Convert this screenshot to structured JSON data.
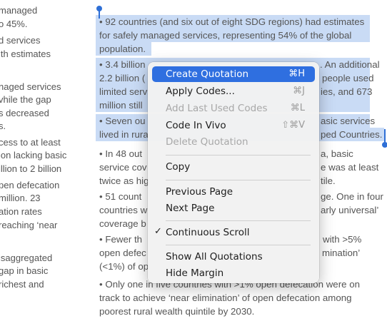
{
  "left_column": [
    "managed",
    "o 45%.",
    "d services",
    "ith estimates",
    "naged services",
    "vhile the gap",
    "s decreased",
    "s.",
    "cess to at least",
    "ion lacking basic",
    "illion to 2 billion",
    "pen defecation",
    "million. 23",
    "ation rates",
    "reaching ‘near",
    "isaggregated",
    "gap in basic",
    "richest and"
  ],
  "main_lines": [
    "•  92 countries (and six out of eight SDG regions) had estimates",
    "for safely managed services, representing 54% of the global",
    "population.",
    "•  3.4 billion",
    "2.2 billion (",
    "limited serv",
    "million still",
    "•  Seven ou",
    "lived in rura",
    "•  In 48 out",
    "service cov",
    "twice as hig",
    "•  51 count",
    "countries w",
    "coverage b",
    "•  Fewer th",
    "open defec",
    "(<1%) of op",
    "•  Only one in five countries with >1% open defecation were on",
    "track to achieve ‘near elimination’ of open defecation among",
    "poorest rural wealth quintile by 2030."
  ],
  "right_fragments": [
    ". An additional",
    "people used",
    "ies, and 673",
    "asic services",
    "ped Countries.",
    "a, basic",
    "e was at least",
    "tile.",
    "ge. One in four",
    "arly universal’",
    "with >5%",
    "mination’"
  ],
  "context_menu": {
    "items": [
      {
        "label": "Create Quotation",
        "shortcut": "⌘H",
        "highlighted": true,
        "disabled": false
      },
      {
        "label": "Apply Codes...",
        "shortcut": "⌘J",
        "disabled": false
      },
      {
        "label": "Add Last Used Codes",
        "shortcut": "⌘L",
        "disabled": true
      },
      {
        "label": "Code In Vivo",
        "shortcut": "⇧⌘V",
        "disabled": false
      },
      {
        "label": "Delete Quotation",
        "shortcut": "",
        "disabled": true
      },
      {
        "label": "Copy",
        "shortcut": "",
        "disabled": false
      },
      {
        "label": "Previous Page",
        "shortcut": "",
        "disabled": false
      },
      {
        "label": "Next Page",
        "shortcut": "",
        "disabled": false
      },
      {
        "label": "Continuous Scroll",
        "shortcut": "",
        "checked": true,
        "disabled": false
      },
      {
        "label": "Show All Quotations",
        "shortcut": "",
        "disabled": false
      },
      {
        "label": "Hide Margin",
        "shortcut": "",
        "disabled": false
      }
    ],
    "check_mark": "✓"
  },
  "colors": {
    "selection": "#c9dbf5",
    "highlight": "#2f6fe0",
    "cursor": "#2e6fd6"
  }
}
